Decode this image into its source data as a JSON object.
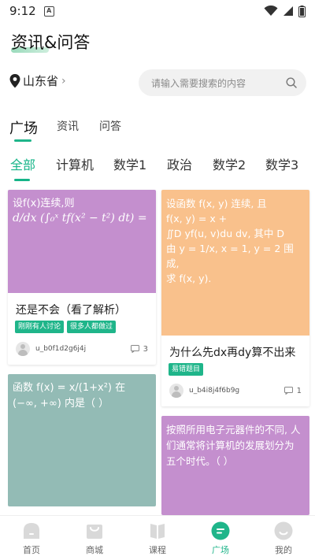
{
  "status_bar": {
    "time": "9:12",
    "notification_letter": "A"
  },
  "header": {
    "title": "资讯&问答"
  },
  "location": {
    "label": "山东省",
    "chevron": "›"
  },
  "search": {
    "placeholder": "请输入需要搜索的内容"
  },
  "primary_tabs": [
    {
      "label": "广场",
      "active": true
    },
    {
      "label": "资讯",
      "active": false
    },
    {
      "label": "问答",
      "active": false
    }
  ],
  "category_tabs": [
    {
      "label": "全部",
      "active": true
    },
    {
      "label": "计算机",
      "active": false
    },
    {
      "label": "数学1",
      "active": false
    },
    {
      "label": "政治",
      "active": false
    },
    {
      "label": "数学2",
      "active": false
    },
    {
      "label": "数学3",
      "active": false
    }
  ],
  "cards": {
    "card1": {
      "thumb_color": "#c48fce",
      "thumb_lines": [
        "设f(x)连续,则",
        "d/dx (∫₀ˣ tf(x² − t²) dt) ="
      ],
      "title": "还是不会（看了解析）",
      "tags": [
        "刚刚有人讨论",
        "很多人都做过"
      ],
      "user": "u_b0f1d2g6j4j",
      "comments": "3"
    },
    "card2": {
      "thumb_color": "#f9c18c",
      "thumb_lines": [
        "设函数 f(x, y) 连续, 且",
        "f(x, y) = x +",
        "∬D yf(u, v)du dv, 其中 D",
        "由 y = 1/x, x = 1, y = 2 围成,",
        "求 f(x, y)."
      ],
      "title": "为什么先dx再dy算不出来",
      "tags": [
        "易错题目"
      ],
      "user": "u_b4i8j4f6b9g",
      "comments": "1"
    },
    "card3": {
      "thumb_color": "#93bbb5",
      "thumb_lines": [
        "函数 f(x) = x/(1+x²) 在",
        "(−∞, +∞) 内是（ ）"
      ]
    },
    "card4": {
      "thumb_color": "#c48fce",
      "thumb_lines": [
        "按照所用电子元器件的不同, 人",
        "们通常将计算机的发展划分为",
        "五个时代。（ ）"
      ]
    }
  },
  "bottom_nav": [
    {
      "label": "首页",
      "icon": "home-icon",
      "active": false
    },
    {
      "label": "商城",
      "icon": "shop-bag-icon",
      "active": false
    },
    {
      "label": "课程",
      "icon": "book-icon",
      "active": false
    },
    {
      "label": "广场",
      "icon": "chat-bubble-icon",
      "active": true
    },
    {
      "label": "我的",
      "icon": "profile-face-icon",
      "active": false
    }
  ],
  "colors": {
    "accent": "#1fb58a",
    "purple_card": "#c48fce",
    "orange_card": "#f9c18c",
    "teal_card": "#93bbb5"
  }
}
